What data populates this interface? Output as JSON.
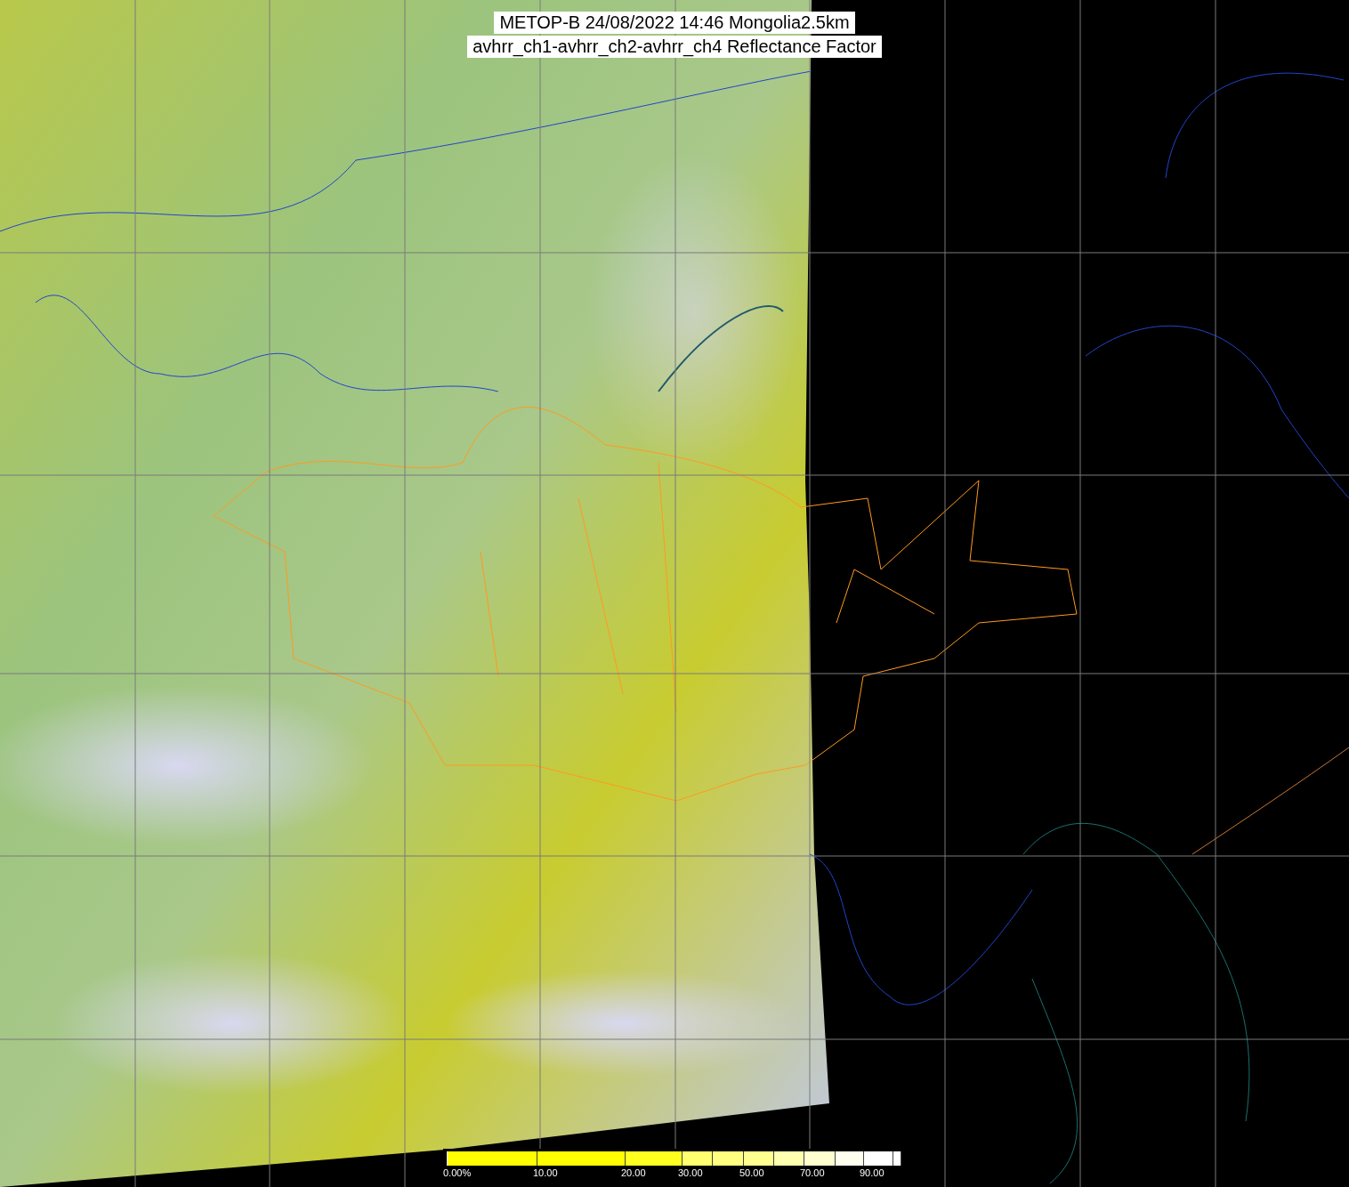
{
  "title": {
    "lines": [
      "METOP-B 24/08/2022 14:46 Mongolia2.5km",
      "avhrr_ch1-avhrr_ch2-avhrr_ch4 Reflectance Factor"
    ]
  },
  "colorbar": {
    "segments": [
      {
        "color": "#ffff00",
        "label": "0.00%"
      },
      {
        "color": "#ffff00",
        "label": "10.00"
      },
      {
        "color": "#ffff20",
        "label": "20.00"
      },
      {
        "color": "#ffff70",
        "label": "30.00"
      },
      {
        "color": "#ffff80"
      },
      {
        "color": "#ffff90",
        "label": "50.00"
      },
      {
        "color": "#ffffb0"
      },
      {
        "color": "#ffffd0",
        "label": "70.00"
      },
      {
        "color": "#ffffee"
      },
      {
        "color": "#ffffff",
        "label": "90.00"
      },
      {
        "color": "#ffffff"
      }
    ]
  }
}
